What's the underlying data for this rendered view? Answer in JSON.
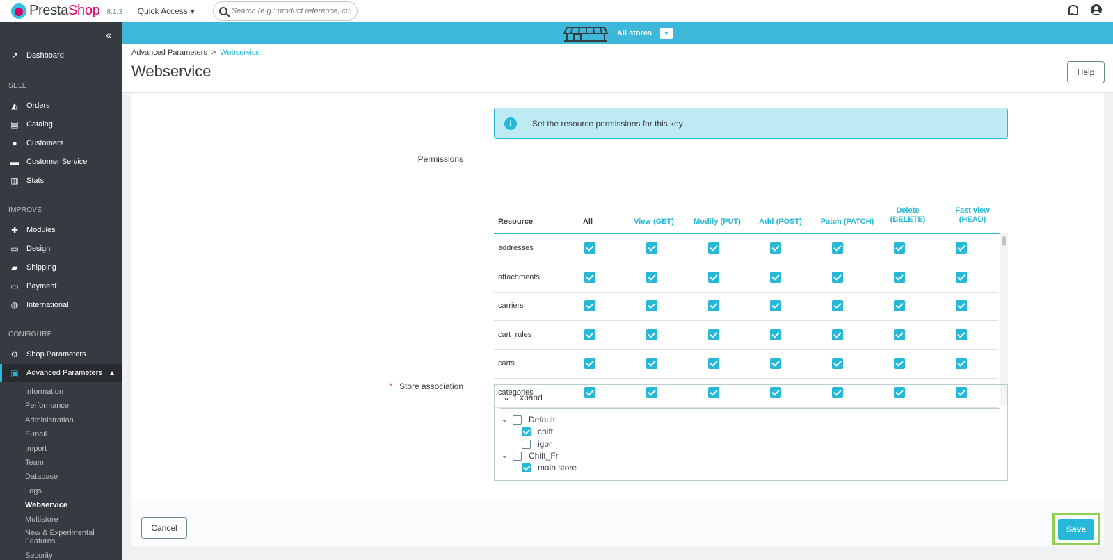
{
  "header": {
    "brand_pre": "Presta",
    "brand_post": "Shop",
    "version": "8.1.3",
    "quick_access": "Quick Access",
    "search_placeholder": "Search (e.g.: product reference, custon"
  },
  "sidebar": {
    "collapse": "«",
    "dashboard": "Dashboard",
    "sections": [
      "SELL",
      "IMPROVE",
      "CONFIGURE"
    ],
    "sell": [
      "Orders",
      "Catalog",
      "Customers",
      "Customer Service",
      "Stats"
    ],
    "improve": [
      "Modules",
      "Design",
      "Shipping",
      "Payment",
      "International"
    ],
    "configure": [
      "Shop Parameters",
      "Advanced Parameters"
    ],
    "sub": [
      "Information",
      "Performance",
      "Administration",
      "E-mail",
      "Import",
      "Team",
      "Database",
      "Logs",
      "Webservice",
      "Multistore",
      "New & Experimental Features",
      "Security"
    ]
  },
  "storebar": {
    "label": "All stores"
  },
  "page": {
    "breadcrumb_parent": "Advanced Parameters",
    "breadcrumb_sep": ">",
    "breadcrumb_current": "Webservice",
    "title": "Webservice",
    "help": "Help"
  },
  "form": {
    "alert": "Set the resource permissions for this key:",
    "permissions_label": "Permissions",
    "store_label": "Store association",
    "required_mark": "*",
    "columns": {
      "resource": "Resource",
      "all": "All",
      "get": "View (GET)",
      "put": "Modify (PUT)",
      "post": "Add (POST)",
      "patch": "Patch (PATCH)",
      "delete_1": "Delete",
      "delete_2": "(DELETE)",
      "head_1": "Fast view",
      "head_2": "(HEAD)"
    },
    "rows": [
      "addresses",
      "attachments",
      "carriers",
      "cart_rules",
      "carts",
      "categories"
    ],
    "expand": "Expand",
    "tree": {
      "default": "Default",
      "chift": "chift",
      "igor": "igor",
      "chift_fr": "Chift_Fr",
      "main_store": "main store"
    },
    "cancel": "Cancel",
    "save": "Save"
  }
}
